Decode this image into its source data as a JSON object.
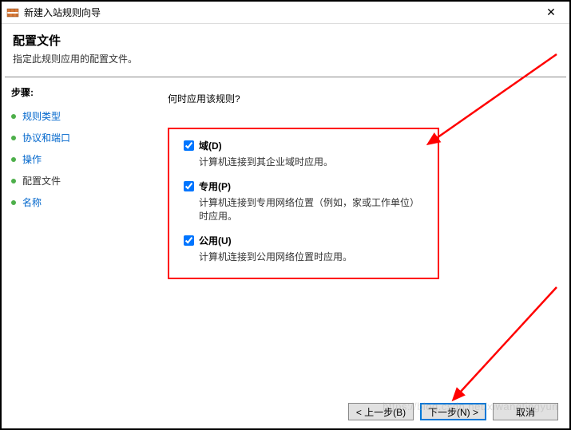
{
  "window": {
    "title": "新建入站规则向导"
  },
  "header": {
    "title": "配置文件",
    "subtitle": "指定此规则应用的配置文件。"
  },
  "sidebar": {
    "title": "步骤:",
    "steps": [
      {
        "label": "规则类型"
      },
      {
        "label": "协议和端口"
      },
      {
        "label": "操作"
      },
      {
        "label": "配置文件"
      },
      {
        "label": "名称"
      }
    ]
  },
  "main": {
    "prompt": "何时应用该规则?",
    "options": [
      {
        "label": "域(D)",
        "desc": "计算机连接到其企业域时应用。"
      },
      {
        "label": "专用(P)",
        "desc": "计算机连接到专用网络位置（例如，家或工作单位）时应用。"
      },
      {
        "label": "公用(U)",
        "desc": "计算机连接到公用网络位置时应用。"
      }
    ]
  },
  "footer": {
    "back": "< 上一步(B)",
    "next": "下一步(N) >",
    "cancel": "取消"
  },
  "watermark": "https://blog.csdn.net/xiwangtingyun"
}
